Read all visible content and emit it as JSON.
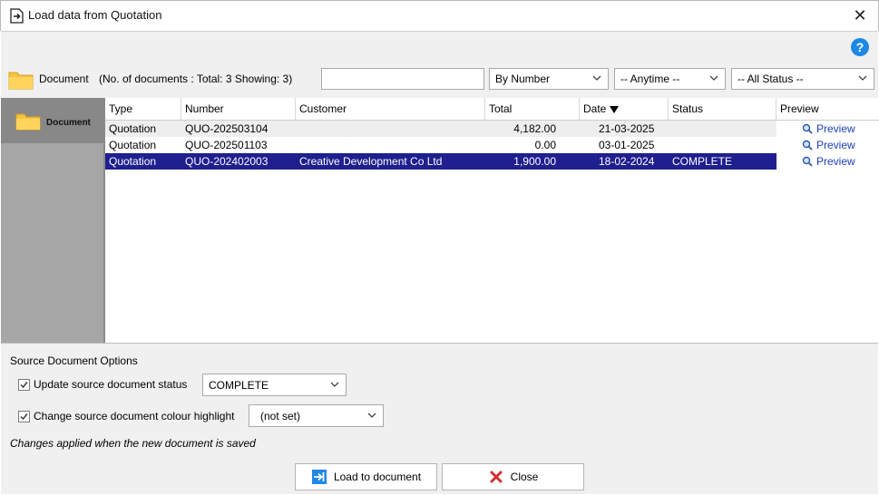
{
  "window": {
    "title": "Load data from Quotation",
    "close_glyph": "✕"
  },
  "help": {
    "label": "?"
  },
  "toolbar": {
    "doc_label": "Document",
    "doc_count": "(No. of documents : Total:  3   Showing:  3)",
    "search_value": "",
    "sort_by": "By Number",
    "date_range": "-- Anytime --",
    "status_filter": "-- All Status --"
  },
  "nav": {
    "item_label": "Document"
  },
  "grid": {
    "columns": [
      "Type",
      "Number",
      "Customer",
      "Total",
      "Date",
      "Status",
      "Preview"
    ],
    "rows": [
      {
        "type": "Quotation",
        "number": "QUO-202503104",
        "customer": "",
        "total": "4,182.00",
        "date": "21-03-2025",
        "status": "",
        "preview": "Preview"
      },
      {
        "type": "Quotation",
        "number": "QUO-202501103",
        "customer": "",
        "total": "0.00",
        "date": "03-01-2025",
        "status": "",
        "preview": "Preview"
      },
      {
        "type": "Quotation",
        "number": "QUO-202402003",
        "customer": "Creative Development Co Ltd",
        "total": "1,900.00",
        "date": "18-02-2024",
        "status": "COMPLETE",
        "preview": "Preview"
      }
    ],
    "selected_row": 2
  },
  "options": {
    "title": "Source Document Options",
    "update_status_label": "Update source document status",
    "update_status_checked": true,
    "update_status_value": "COMPLETE",
    "colour_highlight_label": "Change source document colour highlight",
    "colour_highlight_checked": true,
    "colour_highlight_value": "(not set)",
    "note": "Changes applied when the new document is saved"
  },
  "buttons": {
    "load_label": "Load to document",
    "close_label": "Close"
  },
  "colors": {
    "selection": "#1f1f8f",
    "link": "#1a3fb5",
    "help": "#1e88e5",
    "folder": "#f6c343",
    "close_icon": "#d32f2f",
    "load_icon": "#1e88e5"
  }
}
